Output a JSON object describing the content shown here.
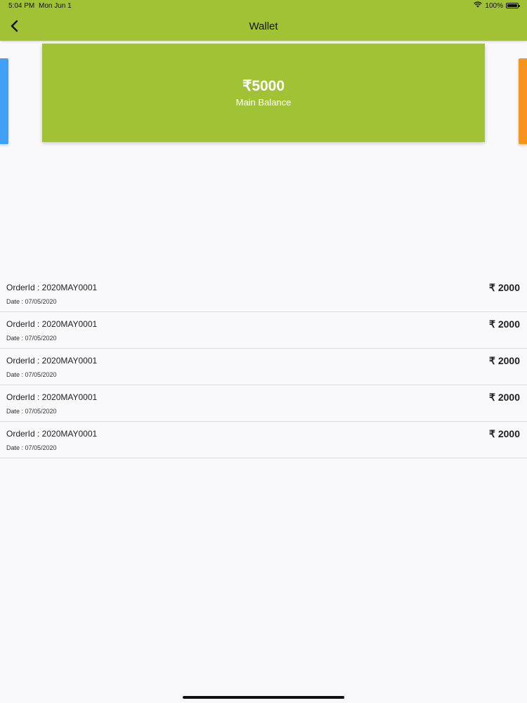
{
  "status_bar": {
    "time": "5:04 PM",
    "date": "Mon Jun 1",
    "battery": "100%",
    "icons": [
      "wifi-icon",
      "battery-icon"
    ]
  },
  "header": {
    "title": "Wallet",
    "back_icon": "chevron-left-icon"
  },
  "balance_card": {
    "amount": "₹5000",
    "label": "Main Balance"
  },
  "colors": {
    "header_bg": "#a2c236",
    "card_bg": "#a2c236",
    "left_card": "#3fa0f5",
    "right_card": "#f7941d"
  },
  "transactions": [
    {
      "order": "OrderId : 2020MAY0001",
      "date": "Date : 07/05/2020",
      "amount": "₹ 2000"
    },
    {
      "order": "OrderId : 2020MAY0001",
      "date": "Date : 07/05/2020",
      "amount": "₹ 2000"
    },
    {
      "order": "OrderId : 2020MAY0001",
      "date": "Date : 07/05/2020",
      "amount": "₹ 2000"
    },
    {
      "order": "OrderId : 2020MAY0001",
      "date": "Date : 07/05/2020",
      "amount": "₹ 2000"
    },
    {
      "order": "OrderId : 2020MAY0001",
      "date": "Date : 07/05/2020",
      "amount": "₹ 2000"
    }
  ]
}
